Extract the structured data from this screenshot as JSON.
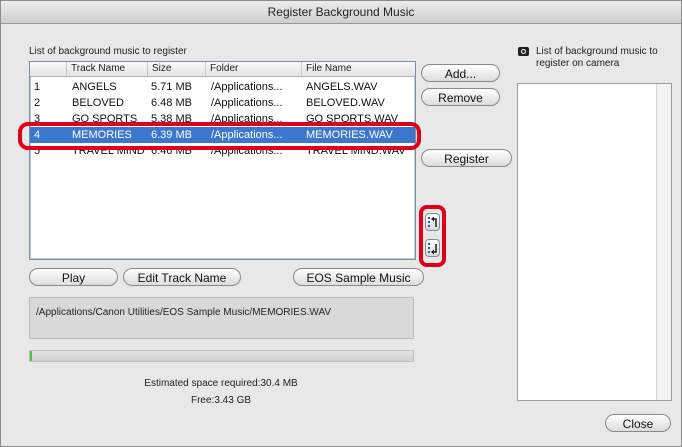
{
  "window": {
    "title": "Register Background Music"
  },
  "left_panel": {
    "list_label": "List of background music to register",
    "columns": [
      "Track Name",
      "Size",
      "Folder",
      "File Name"
    ],
    "rows": [
      {
        "num": "1",
        "track": "ANGELS",
        "size": "5.71 MB",
        "folder": "/Applications...",
        "file": "ANGELS.WAV"
      },
      {
        "num": "2",
        "track": "BELOVED",
        "size": "6.48 MB",
        "folder": "/Applications...",
        "file": "BELOVED.WAV"
      },
      {
        "num": "3",
        "track": "GO SPORTS",
        "size": "5.38 MB",
        "folder": "/Applications...",
        "file": "GO SPORTS.WAV"
      },
      {
        "num": "4",
        "track": "MEMORIES",
        "size": "6.39 MB",
        "folder": "/Applications...",
        "file": "MEMORIES.WAV"
      },
      {
        "num": "5",
        "track": "TRAVEL MIND",
        "size": "6.46 MB",
        "folder": "/Applications...",
        "file": "TRAVEL MIND.WAV"
      }
    ],
    "selected_row": 3,
    "buttons": {
      "play": "Play",
      "edit": "Edit Track Name",
      "sample": "EOS Sample Music"
    },
    "path": "/Applications/Canon Utilities/EOS Sample Music/MEMORIES.WAV",
    "progress_fraction": 0.005,
    "estimated_space": "Estimated space required:30.4 MB",
    "free_space": "Free:3.43 GB"
  },
  "middle_buttons": {
    "add": "Add...",
    "remove": "Remove",
    "register": "Register"
  },
  "right_panel": {
    "label_line1": "List of background music to",
    "label_line2": "register on camera",
    "close": "Close"
  },
  "icons": {
    "camera": "camera-icon",
    "move_up": "move-up-icon",
    "move_down": "move-down-icon"
  },
  "colors": {
    "selection": "#3b77cf",
    "highlight_ring": "#e0001a",
    "progress": "#52c34a"
  }
}
